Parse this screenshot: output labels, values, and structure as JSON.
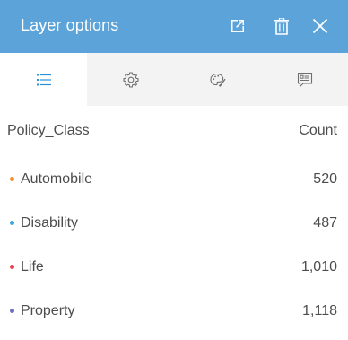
{
  "header": {
    "title": "Layer options",
    "background_color": "#5ba3d9",
    "icons": [
      "popout-icon",
      "trash-icon",
      "close-icon"
    ]
  },
  "tabs": [
    {
      "name": "legend",
      "icon": "list-icon",
      "active": true
    },
    {
      "name": "options",
      "icon": "gear-icon",
      "active": false
    },
    {
      "name": "style",
      "icon": "palette-icon",
      "active": false
    },
    {
      "name": "popup",
      "icon": "popup-icon",
      "active": false
    }
  ],
  "legend": {
    "field_header": "Policy_Class",
    "count_header": "Count",
    "rows": [
      {
        "label": "Automobile",
        "count": "520",
        "color": "#f08d35"
      },
      {
        "label": "Disability",
        "count": "487",
        "color": "#3aa7d9"
      },
      {
        "label": "Life",
        "count": "1,010",
        "color": "#e8434f"
      },
      {
        "label": "Property",
        "count": "1,118",
        "color": "#6d6ec4"
      }
    ]
  }
}
